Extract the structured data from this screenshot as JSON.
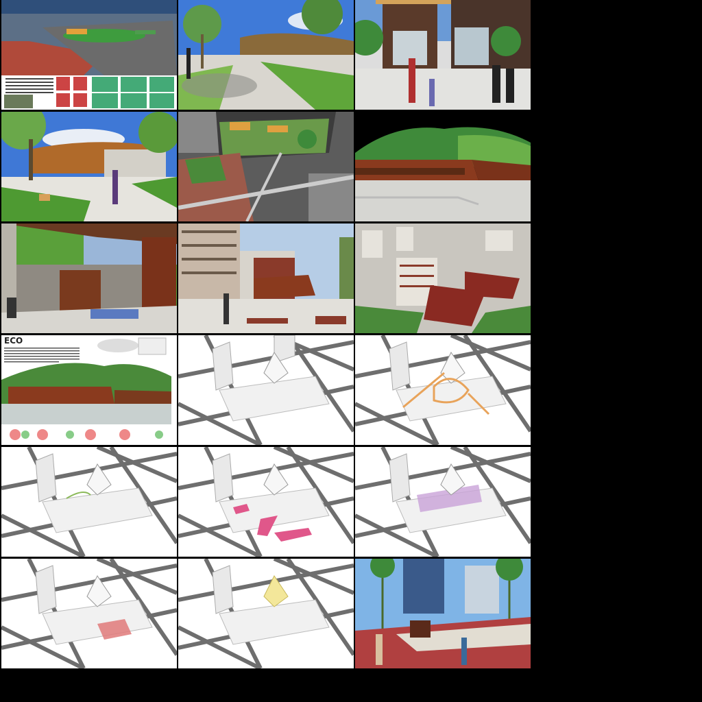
{
  "sheet": {
    "title": "ECO",
    "body_lines": 18
  },
  "colors": {
    "corten": "#8b3a1e",
    "grass": "#4f9a32",
    "sky": "#5a8fd8",
    "plaza": "#e8e6e0",
    "road": "#7a7a7a",
    "highlight_orange": "#e8a35a",
    "highlight_pink": "#e0578a",
    "highlight_lilac": "#c9a2d8",
    "highlight_red": "#e07a7a",
    "highlight_yellow": "#f3e79a"
  }
}
